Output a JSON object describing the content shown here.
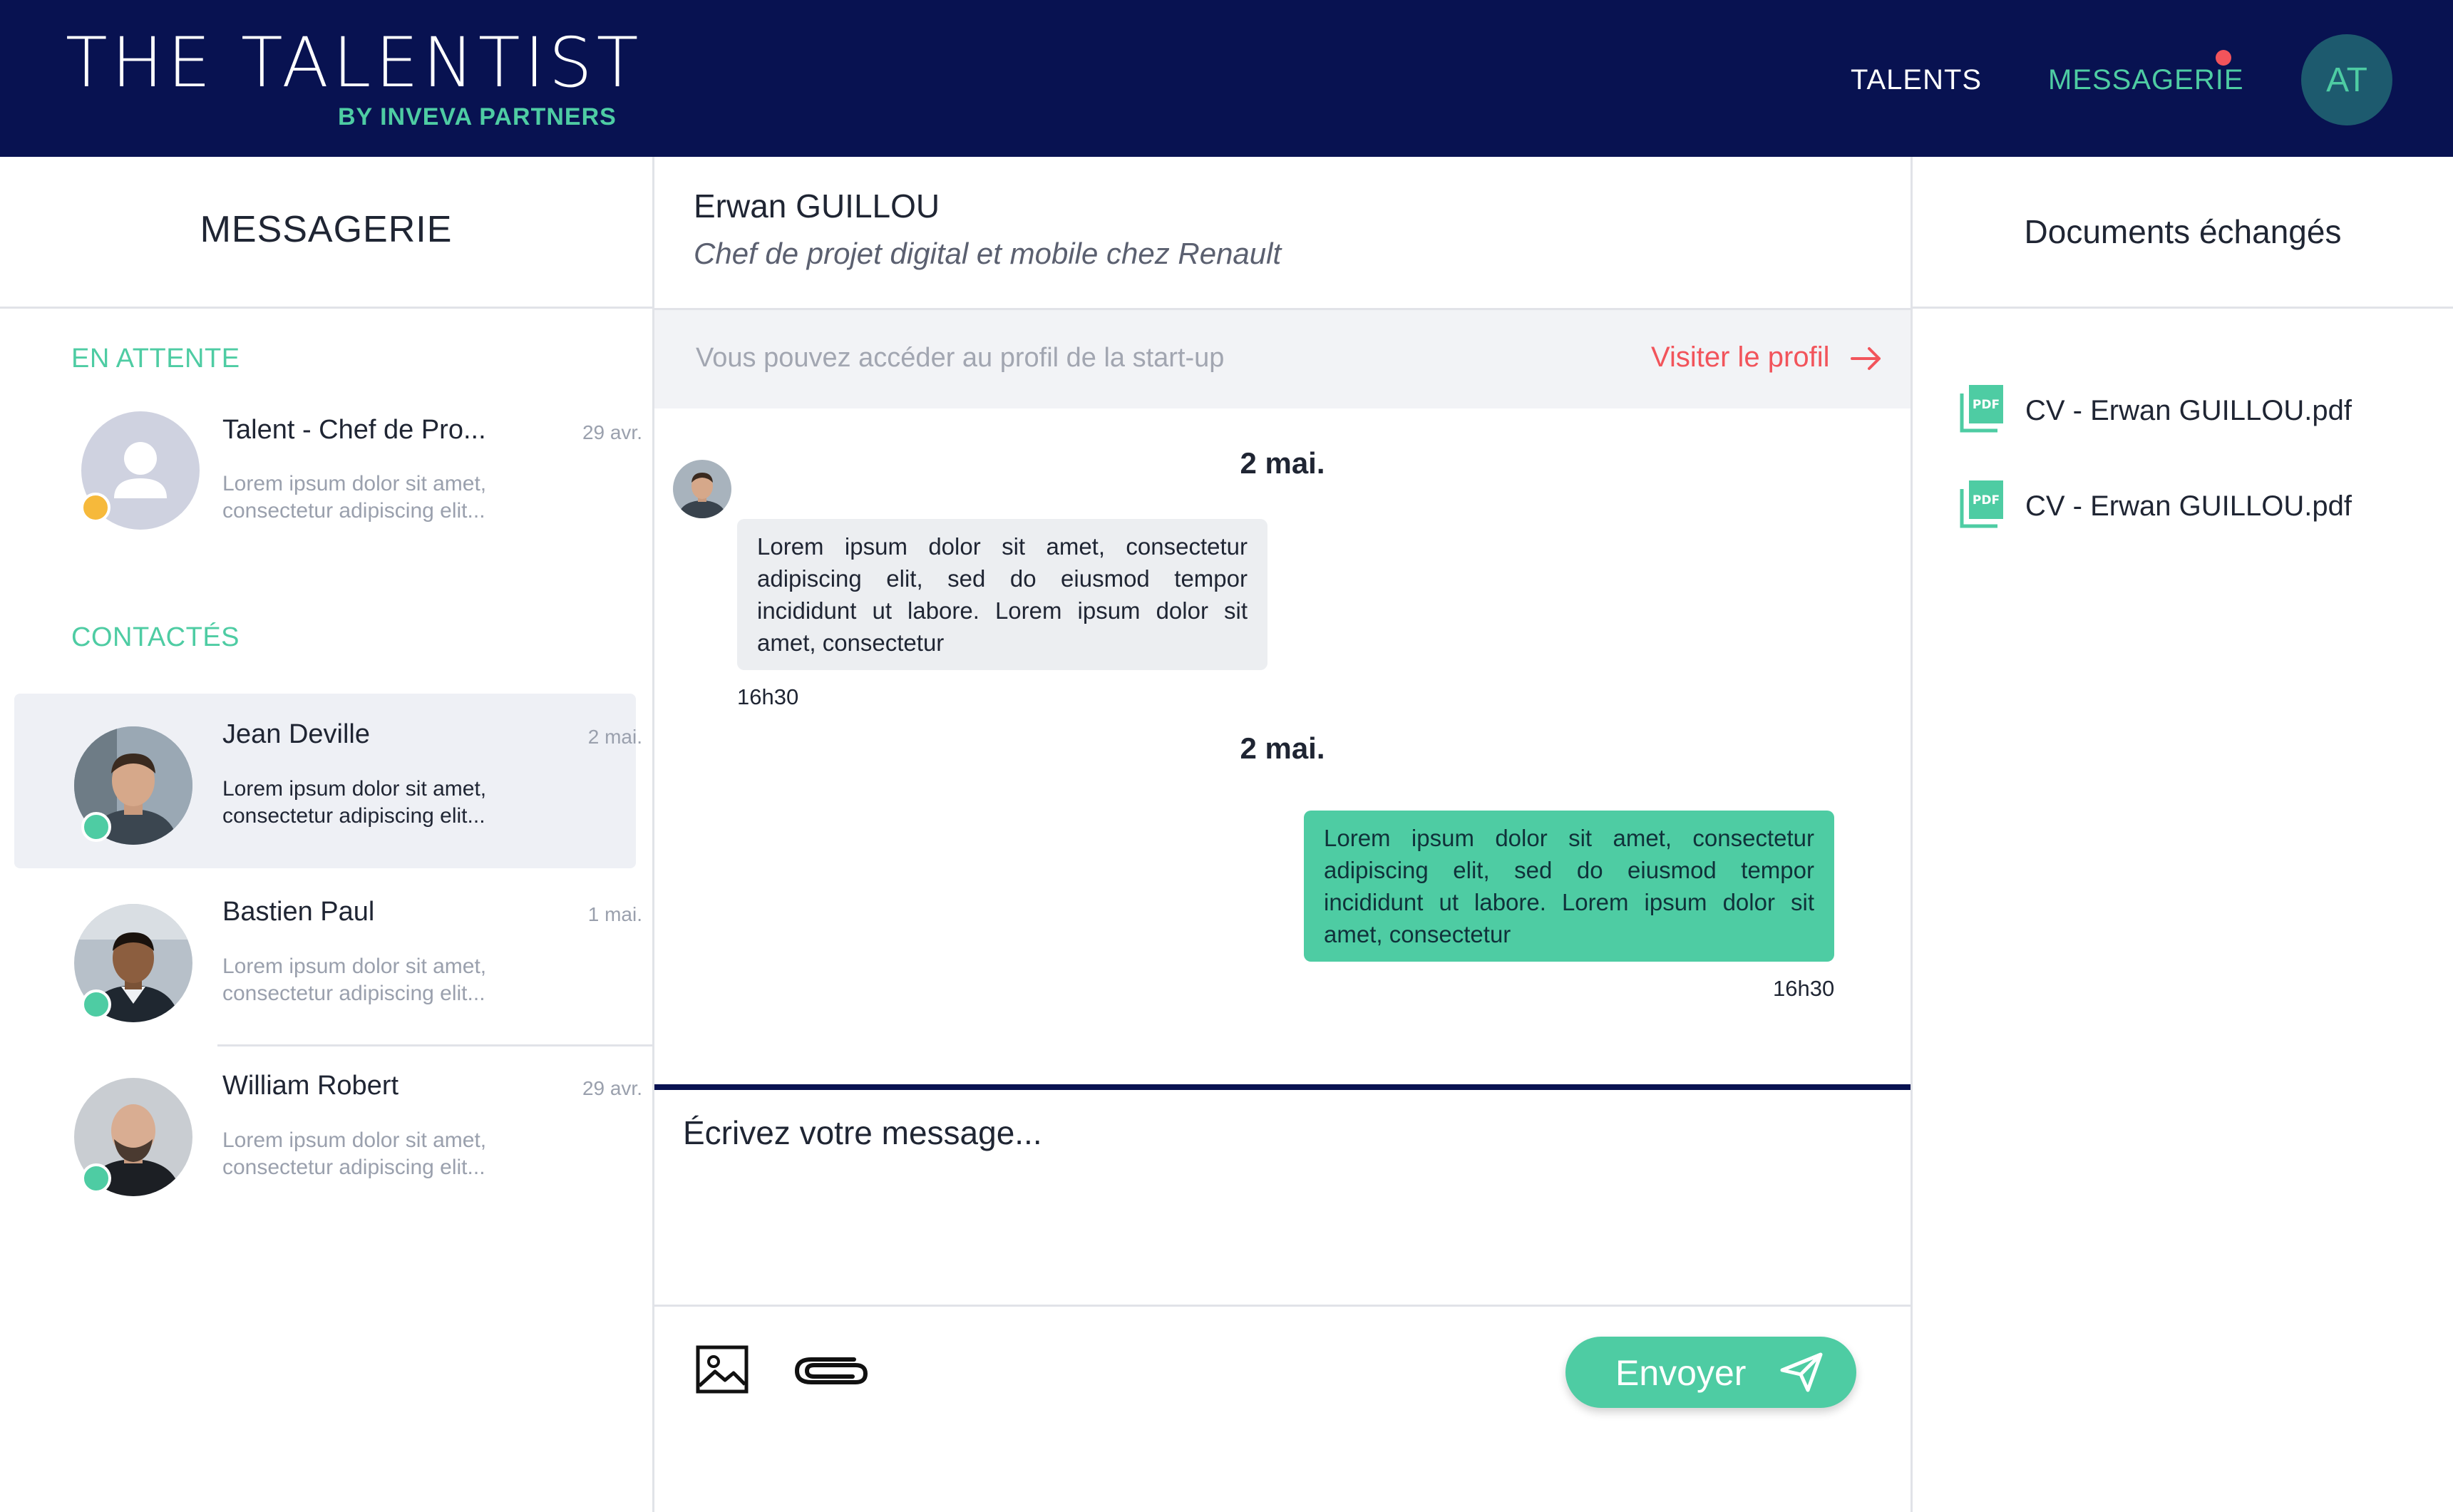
{
  "brand": {
    "title": "THE TALENTIST",
    "subtitle": "BY INVEVA PARTNERS"
  },
  "nav": {
    "talents": "TALENTS",
    "messagerie": "MESSAGERIE",
    "user_initials": "AT"
  },
  "colors": {
    "navy": "#081251",
    "accent": "#4ecca3",
    "alert": "#f2545b",
    "pending": "#f6b93b"
  },
  "inbox": {
    "title": "MESSAGERIE",
    "pending_label": "EN ATTENTE",
    "contacted_label": "CONTACTÉS",
    "pending": [
      {
        "name": "Talent - Chef de Pro...",
        "date": "29 avr.",
        "preview": "Lorem ipsum dolor sit amet, consectetur adipiscing elit...",
        "status": "pending",
        "avatar": "person-placeholder-icon"
      }
    ],
    "contacted": [
      {
        "name": "Jean Deville",
        "date": "2 mai.",
        "preview": "Lorem ipsum dolor sit amet, consectetur adipiscing elit...",
        "status": "online",
        "unread": true,
        "active": true
      },
      {
        "name": "Bastien Paul",
        "date": "1 mai.",
        "preview": "Lorem ipsum dolor sit amet, consectetur adipiscing elit...",
        "status": "online"
      },
      {
        "name": "William Robert",
        "date": "29 avr.",
        "preview": "Lorem ipsum dolor sit amet, consectetur adipiscing elit...",
        "status": "online"
      }
    ]
  },
  "conversation": {
    "contact_name": "Erwan GUILLOU",
    "contact_role": "Chef de projet digital et mobile chez Renault",
    "profile_hint": "Vous pouvez accéder au profil de la start-up",
    "profile_link": "Visiter le profil",
    "messages": [
      {
        "day": "2 mai.",
        "direction": "incoming",
        "text": "Lorem ipsum dolor sit amet, consectetur adipiscing elit, sed do eiusmod tempor incididunt ut labore. Lorem ipsum dolor sit amet, consectetur",
        "time": "16h30"
      },
      {
        "day": "2 mai.",
        "direction": "outgoing",
        "text": "Lorem ipsum dolor sit amet, consectetur adipiscing elit, sed do eiusmod tempor incididunt ut labore. Lorem ipsum dolor sit amet, consectetur",
        "time": "16h30"
      }
    ],
    "composer": {
      "placeholder": "Écrivez votre message...",
      "send_label": "Envoyer"
    }
  },
  "documents": {
    "title": "Documents échangés",
    "items": [
      {
        "name": "CV - Erwan GUILLOU.pdf",
        "icon": "pdf-file-icon"
      },
      {
        "name": "CV - Erwan GUILLOU.pdf",
        "icon": "pdf-file-icon"
      }
    ]
  }
}
